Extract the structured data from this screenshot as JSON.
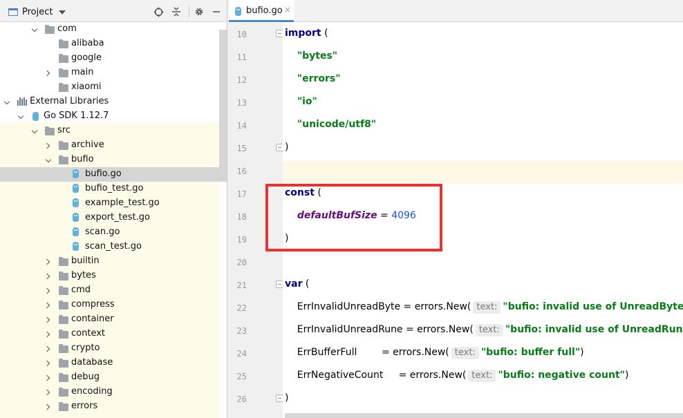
{
  "project_panel": {
    "title": "Project",
    "tree": [
      {
        "label": "com",
        "depth": 2,
        "arrow": "down",
        "icon": "folder-icon"
      },
      {
        "label": "alibaba",
        "depth": 3,
        "arrow": "none",
        "icon": "folder-icon"
      },
      {
        "label": "google",
        "depth": 3,
        "arrow": "none",
        "icon": "folder-icon"
      },
      {
        "label": "main",
        "depth": 3,
        "arrow": "right",
        "icon": "folder-icon"
      },
      {
        "label": "xiaomi",
        "depth": 3,
        "arrow": "none",
        "icon": "folder-icon"
      },
      {
        "label": "External Libraries",
        "depth": 0,
        "arrow": "down",
        "icon": "library-icon"
      },
      {
        "label": "Go SDK 1.12.7",
        "depth": 1,
        "arrow": "down",
        "icon": "go-sdk-icon"
      },
      {
        "label": "src",
        "depth": 2,
        "arrow": "down",
        "icon": "folder-icon"
      },
      {
        "label": "archive",
        "depth": 3,
        "arrow": "right",
        "icon": "folder-icon"
      },
      {
        "label": "bufio",
        "depth": 3,
        "arrow": "down",
        "icon": "folder-icon"
      },
      {
        "label": "bufio.go",
        "depth": 4,
        "arrow": "none",
        "icon": "go-file-icon",
        "selected": true
      },
      {
        "label": "bufio_test.go",
        "depth": 4,
        "arrow": "none",
        "icon": "go-file-icon"
      },
      {
        "label": "example_test.go",
        "depth": 4,
        "arrow": "none",
        "icon": "go-file-icon"
      },
      {
        "label": "export_test.go",
        "depth": 4,
        "arrow": "none",
        "icon": "go-file-icon"
      },
      {
        "label": "scan.go",
        "depth": 4,
        "arrow": "none",
        "icon": "go-file-icon"
      },
      {
        "label": "scan_test.go",
        "depth": 4,
        "arrow": "none",
        "icon": "go-file-icon"
      },
      {
        "label": "builtin",
        "depth": 3,
        "arrow": "right",
        "icon": "folder-icon"
      },
      {
        "label": "bytes",
        "depth": 3,
        "arrow": "right",
        "icon": "folder-icon"
      },
      {
        "label": "cmd",
        "depth": 3,
        "arrow": "right",
        "icon": "folder-icon"
      },
      {
        "label": "compress",
        "depth": 3,
        "arrow": "right",
        "icon": "folder-icon"
      },
      {
        "label": "container",
        "depth": 3,
        "arrow": "right",
        "icon": "folder-icon"
      },
      {
        "label": "context",
        "depth": 3,
        "arrow": "right",
        "icon": "folder-icon"
      },
      {
        "label": "crypto",
        "depth": 3,
        "arrow": "right",
        "icon": "folder-icon"
      },
      {
        "label": "database",
        "depth": 3,
        "arrow": "right",
        "icon": "folder-icon"
      },
      {
        "label": "debug",
        "depth": 3,
        "arrow": "right",
        "icon": "folder-icon"
      },
      {
        "label": "encoding",
        "depth": 3,
        "arrow": "right",
        "icon": "folder-icon"
      },
      {
        "label": "errors",
        "depth": 3,
        "arrow": "right",
        "icon": "folder-icon"
      }
    ]
  },
  "editor": {
    "tab": {
      "label": "bufio.go",
      "close": "×"
    },
    "lines": [
      {
        "num": "10",
        "fold": true,
        "tokens": [
          {
            "t": "kw",
            "v": "import"
          },
          {
            "t": "plain",
            "v": " ("
          }
        ]
      },
      {
        "num": "11",
        "fold": false,
        "tokens": [
          {
            "t": "plain",
            "v": "    "
          },
          {
            "t": "str",
            "v": "\"bytes\""
          }
        ]
      },
      {
        "num": "12",
        "fold": false,
        "tokens": [
          {
            "t": "plain",
            "v": "    "
          },
          {
            "t": "str",
            "v": "\"errors\""
          }
        ]
      },
      {
        "num": "13",
        "fold": false,
        "tokens": [
          {
            "t": "plain",
            "v": "    "
          },
          {
            "t": "str",
            "v": "\"io\""
          }
        ]
      },
      {
        "num": "14",
        "fold": false,
        "tokens": [
          {
            "t": "plain",
            "v": "    "
          },
          {
            "t": "str",
            "v": "\"unicode/utf8\""
          }
        ]
      },
      {
        "num": "15",
        "fold": true,
        "tokens": [
          {
            "t": "plain",
            "v": ")"
          }
        ]
      },
      {
        "num": "16",
        "fold": false,
        "tokens": []
      },
      {
        "num": "17",
        "fold": false,
        "tokens": [
          {
            "t": "kw",
            "v": "const"
          },
          {
            "t": "plain",
            "v": " ("
          }
        ]
      },
      {
        "num": "18",
        "fold": false,
        "tokens": [
          {
            "t": "plain",
            "v": "    "
          },
          {
            "t": "const",
            "v": "defaultBufSize"
          },
          {
            "t": "plain",
            "v": " = "
          },
          {
            "t": "num",
            "v": "4096"
          }
        ]
      },
      {
        "num": "19",
        "fold": false,
        "tokens": [
          {
            "t": "plain",
            "v": ")"
          }
        ]
      },
      {
        "num": "20",
        "fold": false,
        "tokens": []
      },
      {
        "num": "21",
        "fold": true,
        "tokens": [
          {
            "t": "kw",
            "v": "var"
          },
          {
            "t": "plain",
            "v": " ("
          }
        ]
      },
      {
        "num": "22",
        "fold": false,
        "tokens": [
          {
            "t": "plain",
            "v": "    ErrInvalidUnreadByte = errors.New("
          },
          {
            "t": "hint",
            "v": "text:"
          },
          {
            "t": "str",
            "v": "\"bufio: invalid use of UnreadByte\""
          },
          {
            "t": "plain",
            "v": ")"
          }
        ]
      },
      {
        "num": "23",
        "fold": false,
        "tokens": [
          {
            "t": "plain",
            "v": "    ErrInvalidUnreadRune = errors.New("
          },
          {
            "t": "hint",
            "v": "text:"
          },
          {
            "t": "str",
            "v": "\"bufio: invalid use of UnreadRune\""
          },
          {
            "t": "plain",
            "v": ")"
          }
        ]
      },
      {
        "num": "24",
        "fold": false,
        "tokens": [
          {
            "t": "plain",
            "v": "    ErrBufferFull        = errors.New("
          },
          {
            "t": "hint",
            "v": "text:"
          },
          {
            "t": "str",
            "v": "\"bufio: buffer full\""
          },
          {
            "t": "plain",
            "v": ")"
          }
        ]
      },
      {
        "num": "25",
        "fold": false,
        "tokens": [
          {
            "t": "plain",
            "v": "    ErrNegativeCount     = errors.New("
          },
          {
            "t": "hint",
            "v": "text:"
          },
          {
            "t": "str",
            "v": "\"bufio: negative count\""
          },
          {
            "t": "plain",
            "v": ")"
          }
        ]
      },
      {
        "num": "26",
        "fold": true,
        "tokens": [
          {
            "t": "plain",
            "v": ")"
          }
        ]
      }
    ]
  },
  "colors": {
    "keyword": "#000080",
    "string": "#067d17",
    "constant": "#660e7a",
    "number": "#1750eb",
    "annotation_box": "#e8322f"
  }
}
